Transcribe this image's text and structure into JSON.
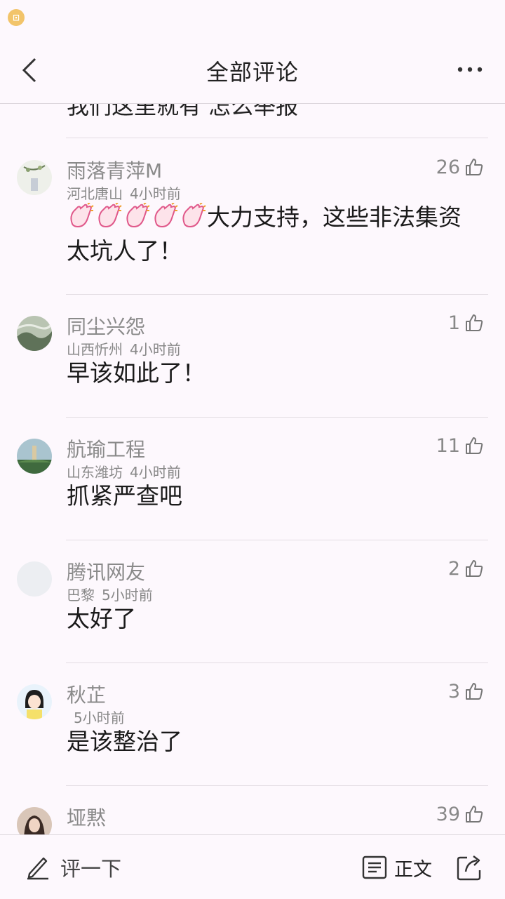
{
  "header": {
    "title": "全部评论"
  },
  "partial_comment": {
    "text": "我们这里就有 怎么举报"
  },
  "comments": [
    {
      "name": "雨落青萍M",
      "location": "河北唐山",
      "time": "4小时前",
      "likes": "26",
      "text": "大力支持，这些非法集资太坑人了！",
      "emoji_prefix": "clap-emoji x5"
    },
    {
      "name": "同尘兴怨",
      "location": "山西忻州",
      "time": "4小时前",
      "likes": "1",
      "text": "早该如此了！"
    },
    {
      "name": "航瑜工程",
      "location": "山东潍坊",
      "time": "4小时前",
      "likes": "11",
      "text": "抓紧严查吧"
    },
    {
      "name": "腾讯网友",
      "location": "巴黎",
      "time": "5小时前",
      "likes": "2",
      "text": "太好了"
    },
    {
      "name": "秋芷",
      "location": "",
      "time": "5小时前",
      "likes": "3",
      "text": "是该整治了"
    },
    {
      "name": "垭黙",
      "location": "",
      "time": "",
      "likes": "39",
      "text": ""
    }
  ],
  "bottom": {
    "write_label": "评一下",
    "article_label": "正文"
  },
  "colors": {
    "background": "#fdf8fd",
    "divider": "#e3dde3",
    "name_gray": "#8a8a8a",
    "text_dark": "#1a1a1a"
  },
  "icons": [
    "back-arrow-icon",
    "more-dots-icon",
    "thumb-up-icon",
    "pen-icon",
    "article-icon",
    "share-icon"
  ]
}
